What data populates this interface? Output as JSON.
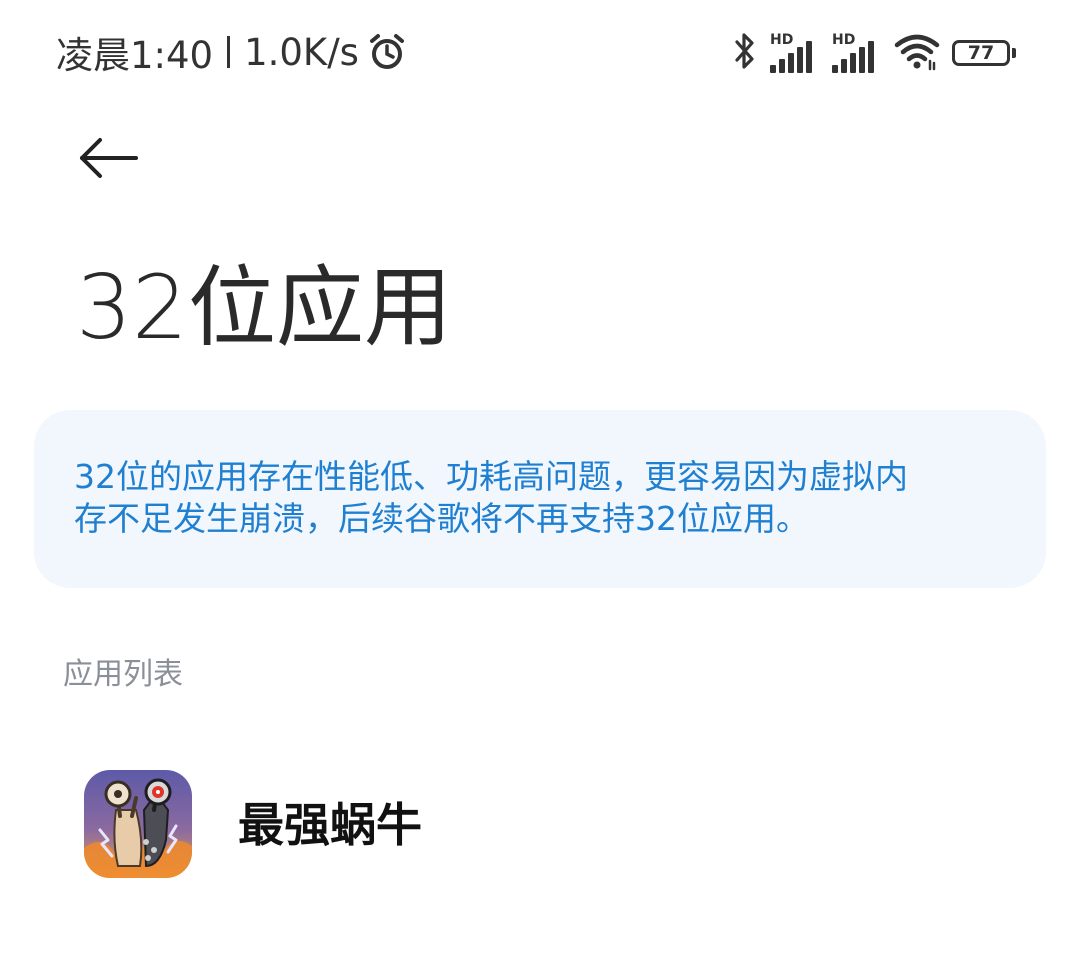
{
  "status_bar": {
    "time": "凌晨1:40",
    "net_speed": "1.0K/s",
    "sim1_label": "HD",
    "sim2_label": "HD",
    "battery_level": "77",
    "icons": [
      "alarm-icon",
      "bluetooth-icon",
      "signal-icon",
      "signal-icon",
      "wifi-icon",
      "battery-icon"
    ]
  },
  "header": {
    "back_icon": "back-arrow-icon",
    "title": "32位应用"
  },
  "info": {
    "text": "32位的应用存在性能低、功耗高问题，更容易因为虚拟内\n存不足发生崩溃，后续谷歌将不再支持32位应用。"
  },
  "app_list": {
    "header": "应用列表",
    "items": [
      {
        "name": "最强蜗牛",
        "icon": "app-icon"
      }
    ]
  },
  "colors": {
    "info_text": "#1f7fd1",
    "info_bg": "#f1f7fd",
    "section_header": "#8a8f99"
  }
}
